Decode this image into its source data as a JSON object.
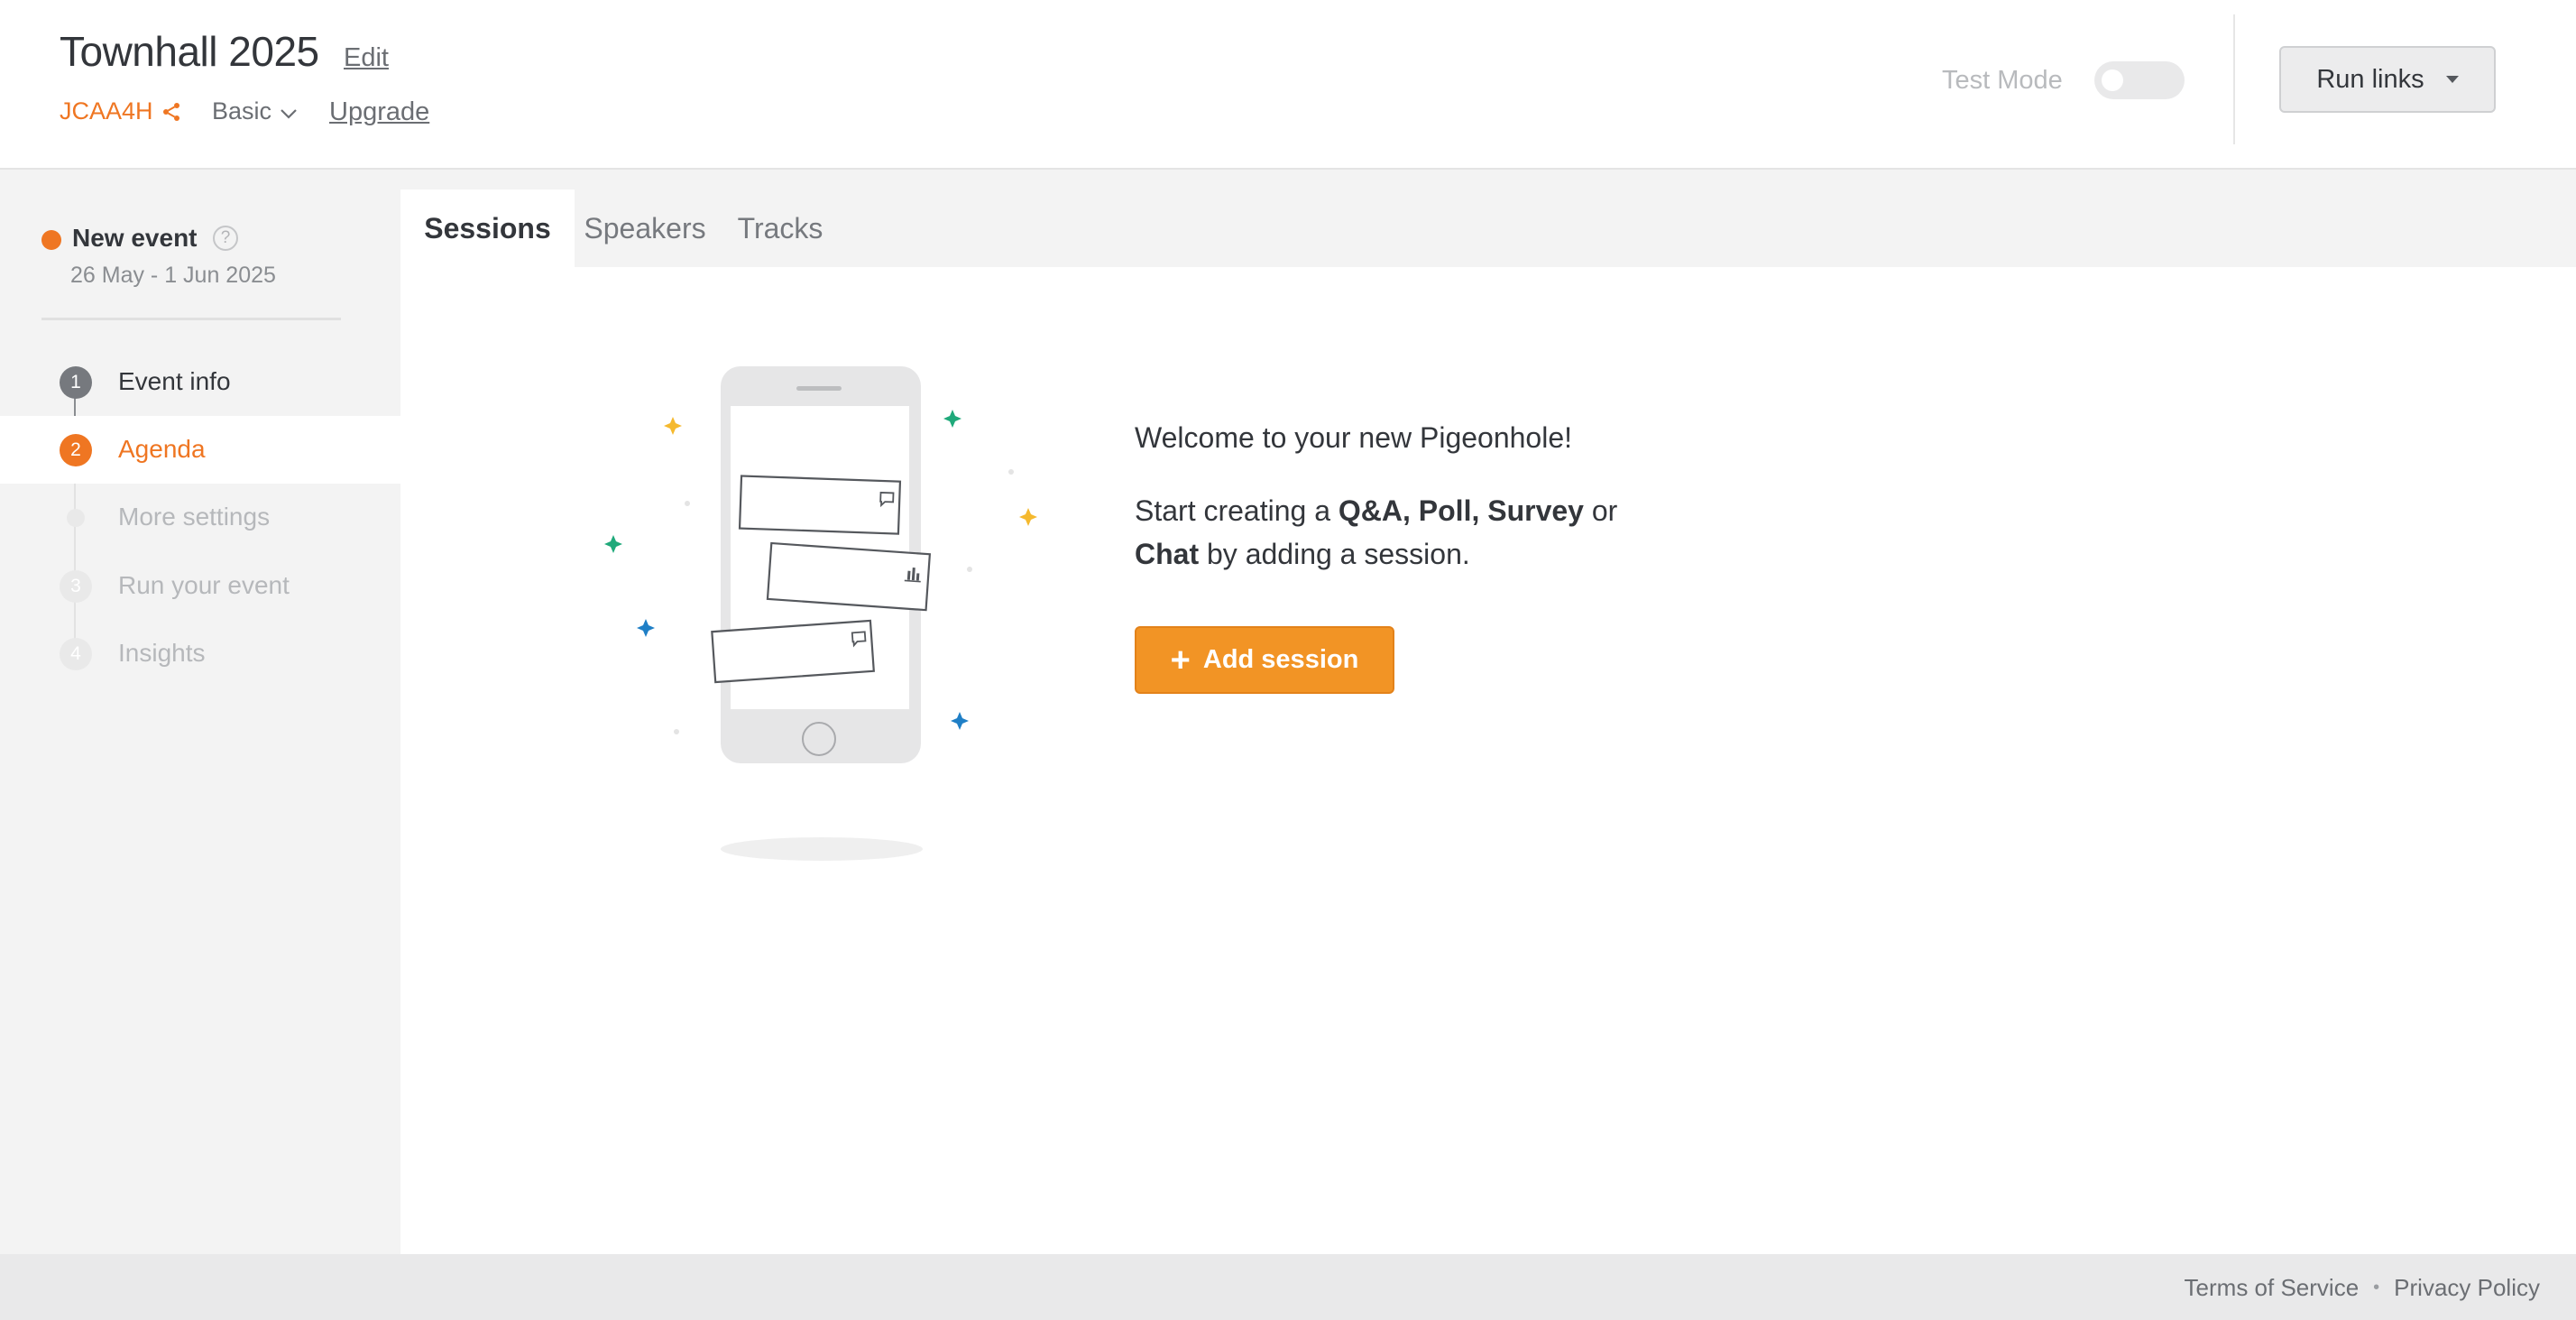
{
  "header": {
    "event_title": "Townhall 2025",
    "edit_label": "Edit",
    "event_code": "JCAA4H",
    "plan": "Basic",
    "upgrade_label": "Upgrade",
    "test_mode_label": "Test Mode",
    "test_mode_on": false,
    "run_links_label": "Run links"
  },
  "sidebar": {
    "event_status": "New event",
    "help_glyph": "?",
    "event_dates": "26 May - 1 Jun 2025",
    "steps": [
      {
        "number": "1",
        "label": "Event info",
        "state": "done"
      },
      {
        "number": "2",
        "label": "Agenda",
        "state": "active"
      },
      {
        "number": "",
        "label": "More settings",
        "state": "disabled"
      },
      {
        "number": "3",
        "label": "Run your event",
        "state": "disabled"
      },
      {
        "number": "4",
        "label": "Insights",
        "state": "disabled"
      }
    ]
  },
  "tabs": [
    {
      "label": "Sessions",
      "active": true
    },
    {
      "label": "Speakers",
      "active": false
    },
    {
      "label": "Tracks",
      "active": false
    }
  ],
  "main": {
    "welcome_title": "Welcome to your new Pigeonhole!",
    "body_prefix": "Start creating a ",
    "body_qa": "Q&A",
    "body_sep1": ", ",
    "body_poll": "Poll",
    "body_sep2": ", ",
    "body_survey": "Survey",
    "body_or": " or",
    "body_chat": "Chat",
    "body_suffix": " by adding a session.",
    "add_session_label": "Add session",
    "add_session_icon": "+"
  },
  "footer": {
    "terms_label": "Terms of Service",
    "separator": "•",
    "privacy_label": "Privacy Policy"
  },
  "colors": {
    "brand_orange": "#ef7622",
    "button_orange": "#f29425",
    "sidebar_bg": "#f3f3f3",
    "text_dark": "#33363b",
    "text_muted": "#6b6e73",
    "sparkle_yellow": "#f5b92e",
    "sparkle_green": "#1fa97a",
    "sparkle_blue": "#1f7fc6"
  },
  "icons": {
    "share": "share-icon",
    "plan_dropdown": "chevron-down-icon",
    "run_links_dropdown": "caret-down-icon",
    "help": "help-circle-icon",
    "add": "plus-icon"
  }
}
